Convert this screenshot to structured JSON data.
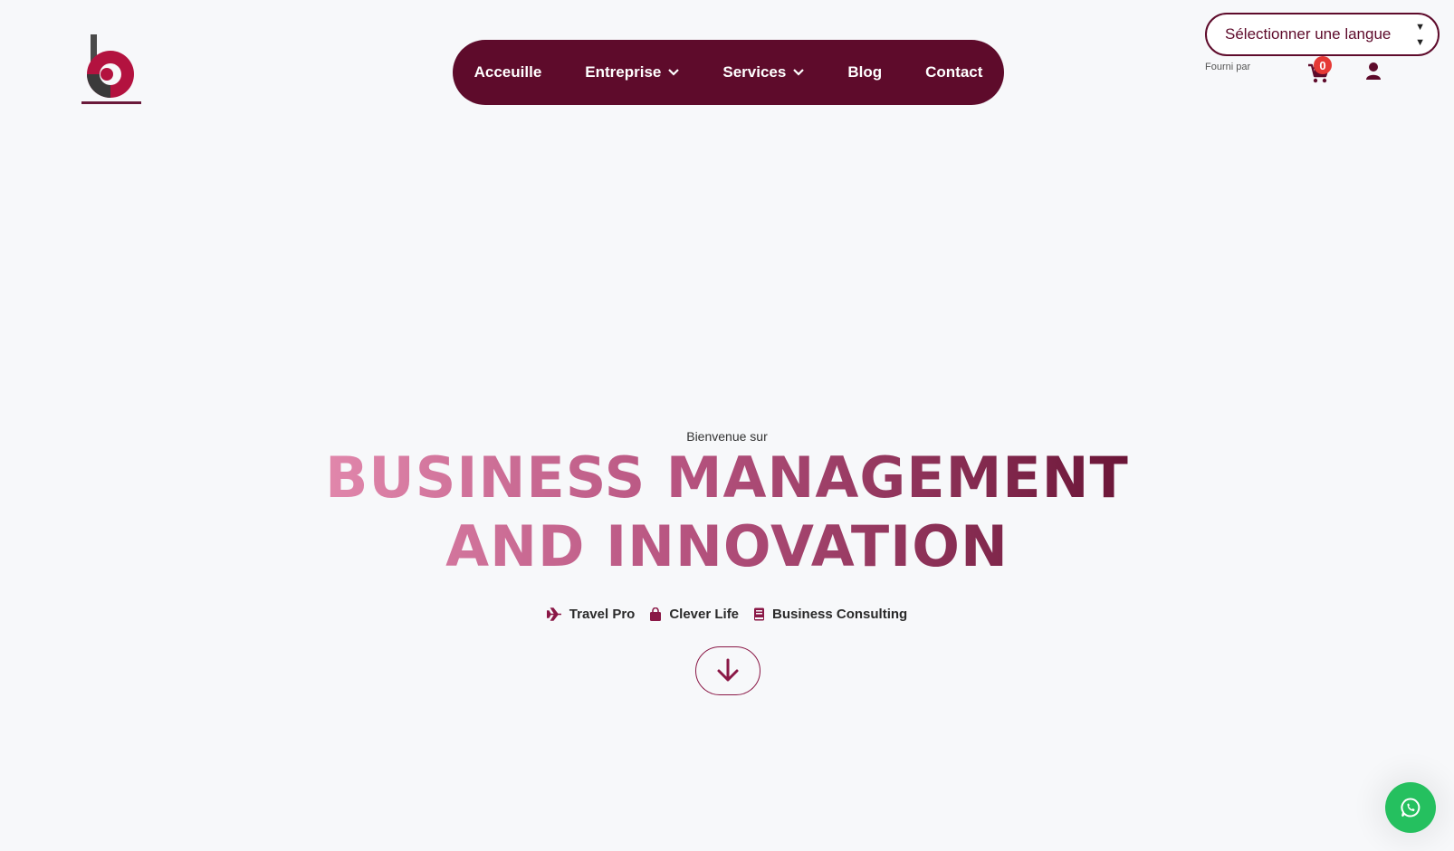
{
  "logo": {
    "icon": "bmi-logo-icon",
    "tagline": "Business Management & Innovation"
  },
  "nav": {
    "items": [
      {
        "label": "Acceuille",
        "has_dropdown": false
      },
      {
        "label": "Entreprise",
        "has_dropdown": true
      },
      {
        "label": "Services",
        "has_dropdown": true
      },
      {
        "label": "Blog",
        "has_dropdown": false
      },
      {
        "label": "Contact",
        "has_dropdown": false
      }
    ]
  },
  "language": {
    "selected": "Sélectionner une langue",
    "powered_by": "Fourni par"
  },
  "cart": {
    "count": "0"
  },
  "hero": {
    "welcome": "Bienvenue sur",
    "title_line1": "BUSINESS MANAGEMENT",
    "title_line2": "AND INNOVATION",
    "pillars": [
      {
        "icon": "plane-icon",
        "label": "Travel Pro"
      },
      {
        "icon": "shopping-bag-icon",
        "label": "Clever Life"
      },
      {
        "icon": "book-icon",
        "label": "Business Consulting"
      }
    ]
  },
  "colors": {
    "brand": "#5e0b2b",
    "accent": "#8a1846",
    "gradient_start": "#e991b4",
    "whatsapp": "#25c05f",
    "badge": "#e53935"
  }
}
